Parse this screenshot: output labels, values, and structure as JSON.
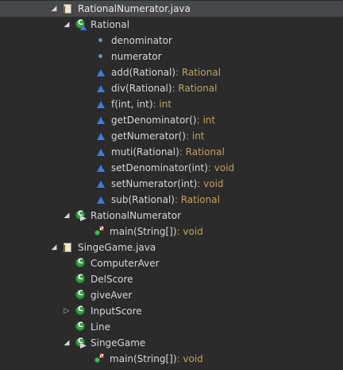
{
  "tree": {
    "file1": {
      "name": "RationalNumerator.java"
    },
    "class_rational": {
      "name": "Rational",
      "members": [
        {
          "label": "denominator",
          "type": "",
          "icon": "field-icon"
        },
        {
          "label": "numerator",
          "type": "",
          "icon": "field-icon"
        },
        {
          "label": "add(Rational)",
          "type": " : Rational",
          "icon": "method-icon"
        },
        {
          "label": "div(Rational)",
          "type": " : Rational",
          "icon": "method-icon"
        },
        {
          "label": "f(int, int)",
          "type": " : int",
          "icon": "method-icon"
        },
        {
          "label": "getDenominator()",
          "type": " : int",
          "icon": "method-icon"
        },
        {
          "label": "getNumerator()",
          "type": " : int",
          "icon": "method-icon"
        },
        {
          "label": "muti(Rational)",
          "type": " : Rational",
          "icon": "method-icon"
        },
        {
          "label": "setDenominator(int)",
          "type": " : void",
          "icon": "method-icon"
        },
        {
          "label": "setNumerator(int)",
          "type": " : void",
          "icon": "method-icon"
        },
        {
          "label": "sub(Rational)",
          "type": " : Rational",
          "icon": "method-icon"
        }
      ]
    },
    "class_rationalnumerator": {
      "name": "RationalNumerator",
      "main": {
        "label": "main(String[])",
        "type": " : void"
      }
    },
    "file2": {
      "name": "SingeGame.java"
    },
    "classes2": [
      {
        "name": "ComputerAver"
      },
      {
        "name": "DelScore"
      },
      {
        "name": "giveAver"
      },
      {
        "name": "InputScore"
      },
      {
        "name": "Line"
      },
      {
        "name": "SingeGame"
      }
    ],
    "singegame_main": {
      "label": "main(String[])",
      "type": " : void"
    }
  },
  "colors": {
    "background": "#2b2b2b",
    "selection": "#46484b",
    "text": "#d7d7d7",
    "return_type": "#c3a05a",
    "class_icon": "#3a9b45",
    "method_icon": "#3c7dd6"
  }
}
